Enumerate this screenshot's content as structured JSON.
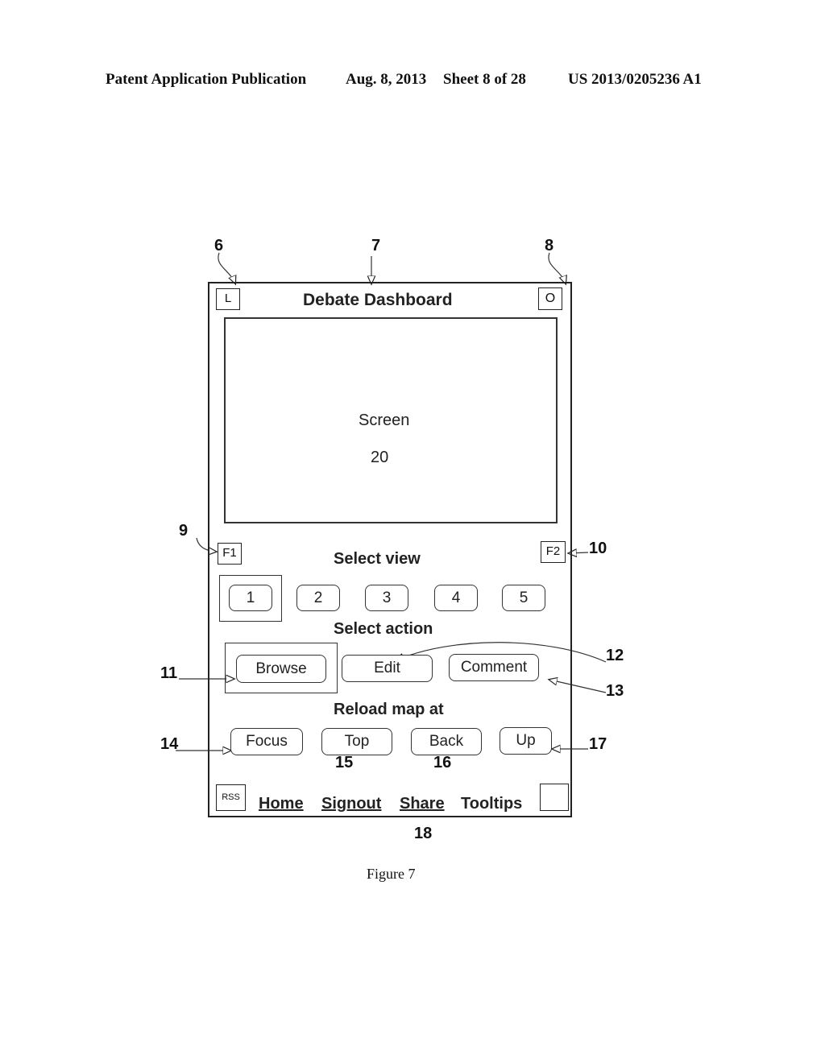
{
  "header": {
    "publication": "Patent Application Publication",
    "date": "Aug. 8, 2013",
    "sheet": "Sheet 8 of 28",
    "number": "US 2013/0205236 A1"
  },
  "dashboard": {
    "title": "Debate Dashboard",
    "left_button": "L",
    "right_button": "O",
    "screen_label": "Screen",
    "screen_ref": "20",
    "f1_button": "F1",
    "f2_button": "F2",
    "select_view_label": "Select view",
    "view_buttons": [
      "1",
      "2",
      "3",
      "4",
      "5"
    ],
    "selected_view": "1",
    "select_action_label": "Select action",
    "action_buttons": [
      "Browse",
      "Edit",
      "Comment"
    ],
    "selected_action": "Browse",
    "reload_label": "Reload map at",
    "reload_buttons": [
      "Focus",
      "Top",
      "Back",
      "Up"
    ],
    "footer": {
      "rss_button": "RSS",
      "links": [
        "Home",
        "Signout",
        "Share"
      ],
      "tooltips_label": "Tooltips",
      "tooltips_checkbox_checked": false
    }
  },
  "reference_numerals": {
    "r6": "6",
    "r7": "7",
    "r8": "8",
    "r9": "9",
    "r10": "10",
    "r11": "11",
    "r12": "12",
    "r13": "13",
    "r14": "14",
    "r15": "15",
    "r16": "16",
    "r17": "17",
    "r18": "18"
  },
  "caption": "Figure 7"
}
